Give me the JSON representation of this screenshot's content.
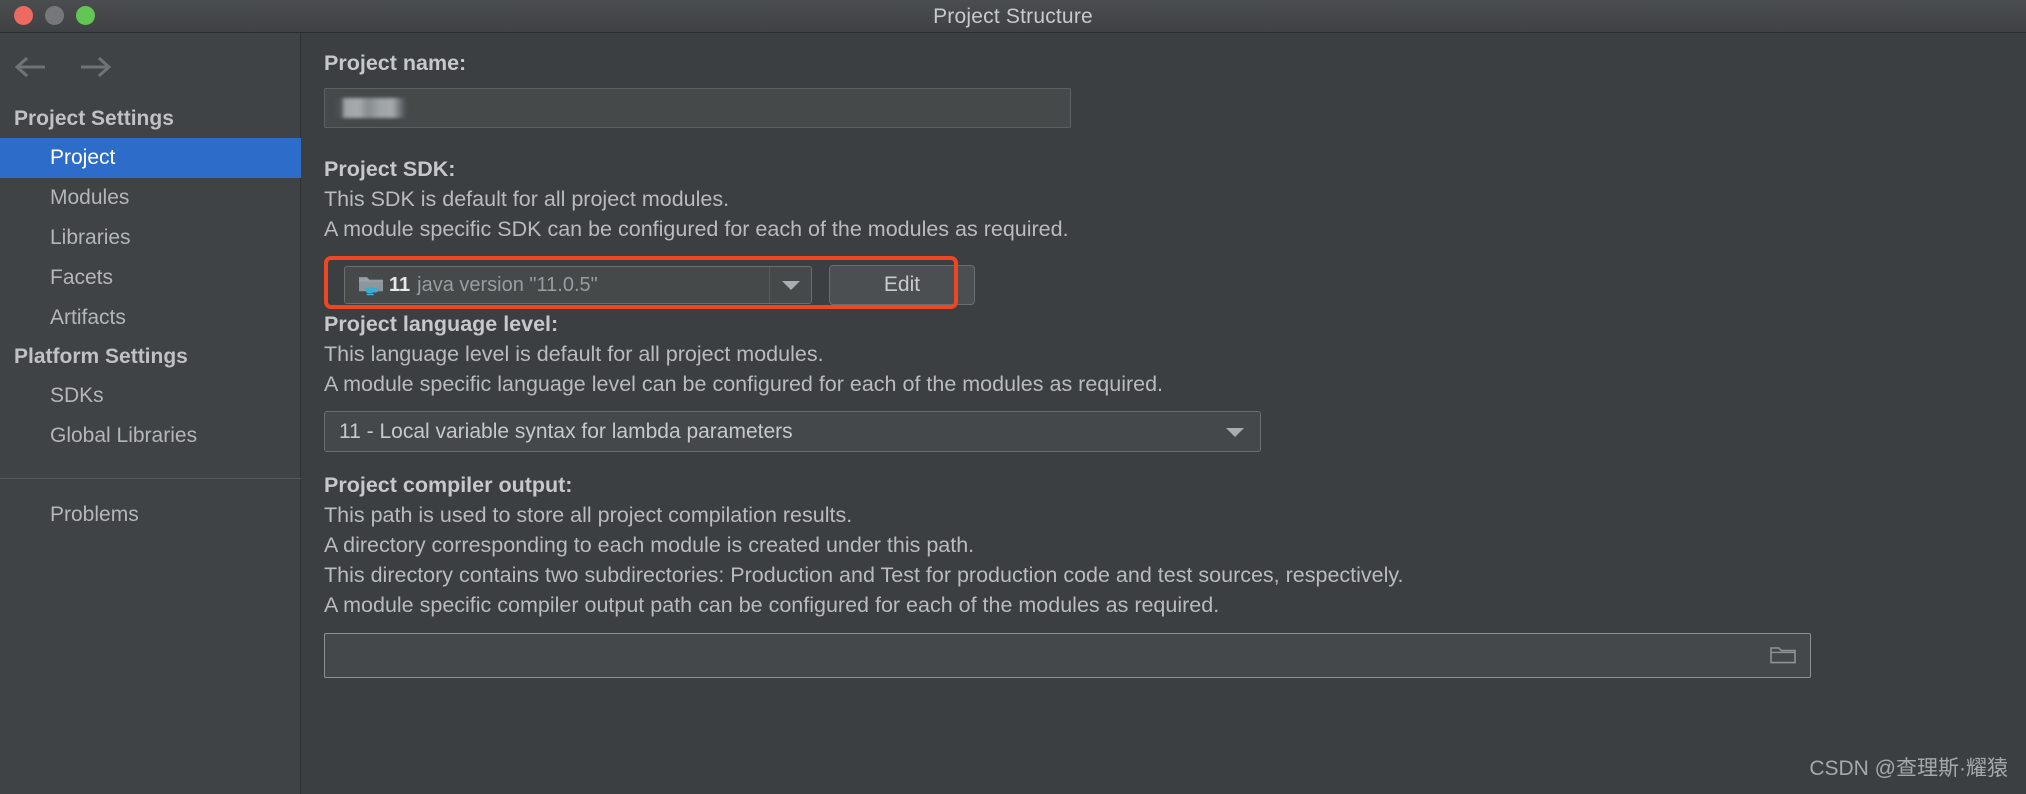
{
  "window": {
    "title": "Project Structure",
    "traffic_lights": [
      "close",
      "minimize",
      "maximize"
    ]
  },
  "sidebar": {
    "nav": {
      "back_icon": "arrow-left-icon",
      "forward_icon": "arrow-right-icon"
    },
    "groups": [
      {
        "header": "Project Settings",
        "items": [
          {
            "label": "Project",
            "selected": true
          },
          {
            "label": "Modules",
            "selected": false
          },
          {
            "label": "Libraries",
            "selected": false
          },
          {
            "label": "Facets",
            "selected": false
          },
          {
            "label": "Artifacts",
            "selected": false
          }
        ]
      },
      {
        "header": "Platform Settings",
        "items": [
          {
            "label": "SDKs",
            "selected": false
          },
          {
            "label": "Global Libraries",
            "selected": false
          }
        ]
      }
    ],
    "footer_items": [
      {
        "label": "Problems",
        "selected": false
      }
    ]
  },
  "main": {
    "project_name": {
      "label": "Project name:",
      "value": "",
      "redacted": true
    },
    "project_sdk": {
      "label": "Project SDK:",
      "desc_line_1": "This SDK is default for all project modules.",
      "desc_line_2": "A module specific SDK can be configured for each of the modules as required.",
      "selected_version": "11",
      "selected_description": "java version \"11.0.5\"",
      "icon": "folder-java-icon",
      "dropdown_icon": "chevron-down-icon",
      "edit_button": "Edit",
      "highlight_color": "#f04523"
    },
    "language_level": {
      "label": "Project language level:",
      "desc_line_1": "This language level is default for all project modules.",
      "desc_line_2": "A module specific language level can be configured for each of the modules as required.",
      "selected": "11 - Local variable syntax for lambda parameters",
      "dropdown_icon": "chevron-down-icon"
    },
    "compiler_output": {
      "label": "Project compiler output:",
      "desc_line_1": "This path is used to store all project compilation results.",
      "desc_line_2": "A directory corresponding to each module is created under this path.",
      "desc_line_3": "This directory contains two subdirectories: Production and Test for production code and test sources, respectively.",
      "desc_line_4": "A module specific compiler output path can be configured for each of the modules as required.",
      "value": "",
      "browse_icon": "folder-icon"
    }
  },
  "watermark": "CSDN @查理斯·耀猿",
  "colors": {
    "accent_selected": "#2d6cc8",
    "highlight_red": "#f04523",
    "background": "#3c3f41",
    "sidebar_background": "#3f4345"
  }
}
